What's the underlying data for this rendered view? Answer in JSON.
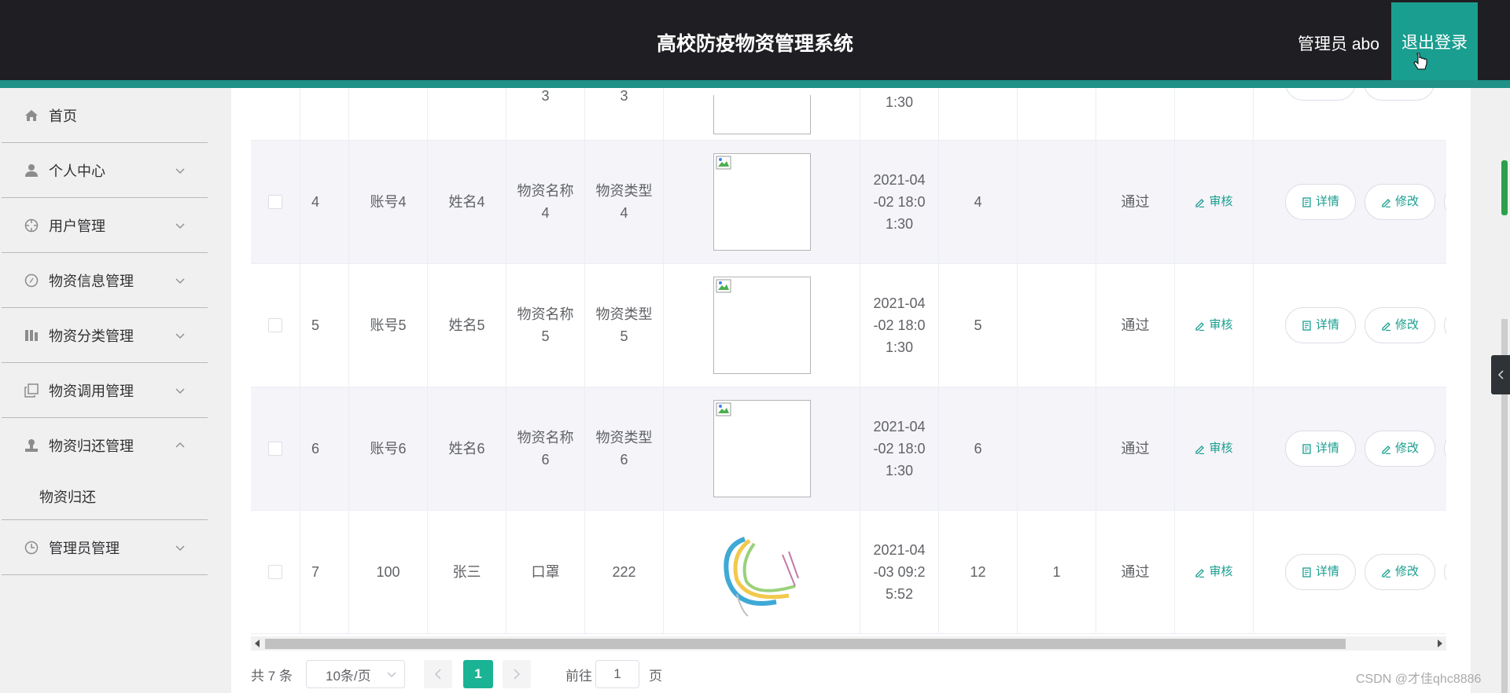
{
  "header": {
    "title": "高校防疫物资管理系统",
    "admin_label": "管理员 abo",
    "logout_label": "退出登录"
  },
  "sidebar": {
    "items": [
      {
        "label": "首页",
        "icon": "home-icon",
        "expandable": false
      },
      {
        "label": "个人中心",
        "icon": "user-icon",
        "expandable": true
      },
      {
        "label": "用户管理",
        "icon": "crosshair-icon",
        "expandable": true
      },
      {
        "label": "物资信息管理",
        "icon": "compass-icon",
        "expandable": true
      },
      {
        "label": "物资分类管理",
        "icon": "category-icon",
        "expandable": true
      },
      {
        "label": "物资调用管理",
        "icon": "copy-icon",
        "expandable": true
      },
      {
        "label": "物资归还管理",
        "icon": "stamp-icon",
        "expandable": true,
        "expanded": true
      },
      {
        "label": "管理员管理",
        "icon": "clock-icon",
        "expandable": true
      }
    ],
    "submenu": {
      "label": "物资归还"
    }
  },
  "table": {
    "partial_row": {
      "name": "3",
      "type": "3",
      "time": "1:30"
    },
    "rows": [
      {
        "id": "4",
        "account": "账号4",
        "name": "姓名4",
        "goods_name": "物资名称4",
        "goods_type": "物资类型4",
        "time": "2021-04-02 18:01:30",
        "qty": "4",
        "returned": "",
        "status": "通过"
      },
      {
        "id": "5",
        "account": "账号5",
        "name": "姓名5",
        "goods_name": "物资名称5",
        "goods_type": "物资类型5",
        "time": "2021-04-02 18:01:30",
        "qty": "5",
        "returned": "",
        "status": "通过"
      },
      {
        "id": "6",
        "account": "账号6",
        "name": "姓名6",
        "goods_name": "物资名称6",
        "goods_type": "物资类型6",
        "time": "2021-04-02 18:01:30",
        "qty": "6",
        "returned": "",
        "status": "通过"
      },
      {
        "id": "7",
        "account": "100",
        "name": "张三",
        "goods_name": "口罩",
        "goods_type": "222",
        "time": "2021-04-03 09:25:52",
        "qty": "12",
        "returned": "1",
        "status": "通过"
      }
    ],
    "actions": {
      "review": "审核",
      "detail": "详情",
      "edit": "修改"
    },
    "time_lines": [
      [
        "2021-04",
        "-02 18:0",
        "1:30"
      ],
      [
        "2021-04",
        "-02 18:0",
        "1:30"
      ],
      [
        "2021-04",
        "-02 18:0",
        "1:30"
      ],
      [
        "2021-04",
        "-03 09:2",
        "5:52"
      ]
    ],
    "name_lines": [
      [
        "物资名称",
        "4",
        "物资类型",
        "4"
      ],
      [
        "物资名称",
        "5",
        "物资类型",
        "5"
      ],
      [
        "物资名称",
        "6",
        "物资类型",
        "6"
      ]
    ]
  },
  "pagination": {
    "total_label": "共 7 条",
    "page_size_label": "10条/页",
    "current_page": "1",
    "goto_label": "前往",
    "goto_value": "1",
    "page_suffix": "页"
  },
  "watermark": "CSDN @才佳qhc8886",
  "colors": {
    "header_bg": "#1f1e22",
    "accent": "#1a9e8f",
    "active_page": "#1ab394"
  }
}
